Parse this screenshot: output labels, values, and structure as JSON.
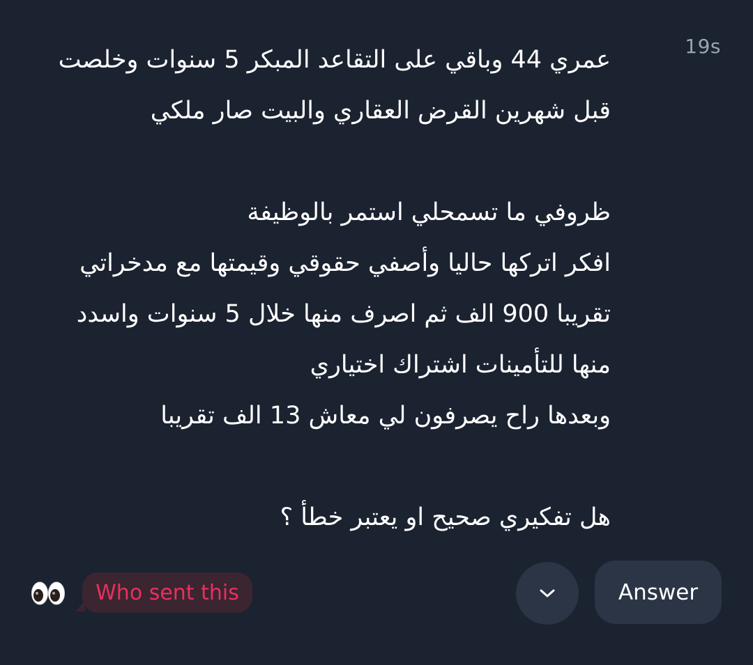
{
  "question": {
    "timestamp": "19s",
    "lines": [
      "عمري 44 وباقي على التقاعد المبكر 5 سنوات وخلصت",
      "قبل شهرين القرض العقاري والبيت صار ملكي",
      "",
      "ظروفي ما تسمحلي استمر بالوظيفة",
      "افكر اتركها حاليا وأصفي حقوقي وقيمتها مع مدخراتي",
      "تقريبا 900 الف ثم اصرف منها خلال 5 سنوات واسدد",
      "منها للتأمينات اشتراك اختياري",
      " وبعدها راح يصرفون لي معاش 13 الف تقريبا",
      "",
      "هل تفكيري صحيح او يعتبر خطأ ؟"
    ]
  },
  "footer": {
    "eyes_icon": "eyes-emoji-icon",
    "who_sent_label": "Who sent this",
    "who_sent_color": "#e8305f",
    "expand_icon": "chevron-down-icon",
    "answer_label": "Answer"
  },
  "colors": {
    "background": "#1b2230",
    "button_background": "#2b3546",
    "timestamp": "#9aa3b3"
  }
}
